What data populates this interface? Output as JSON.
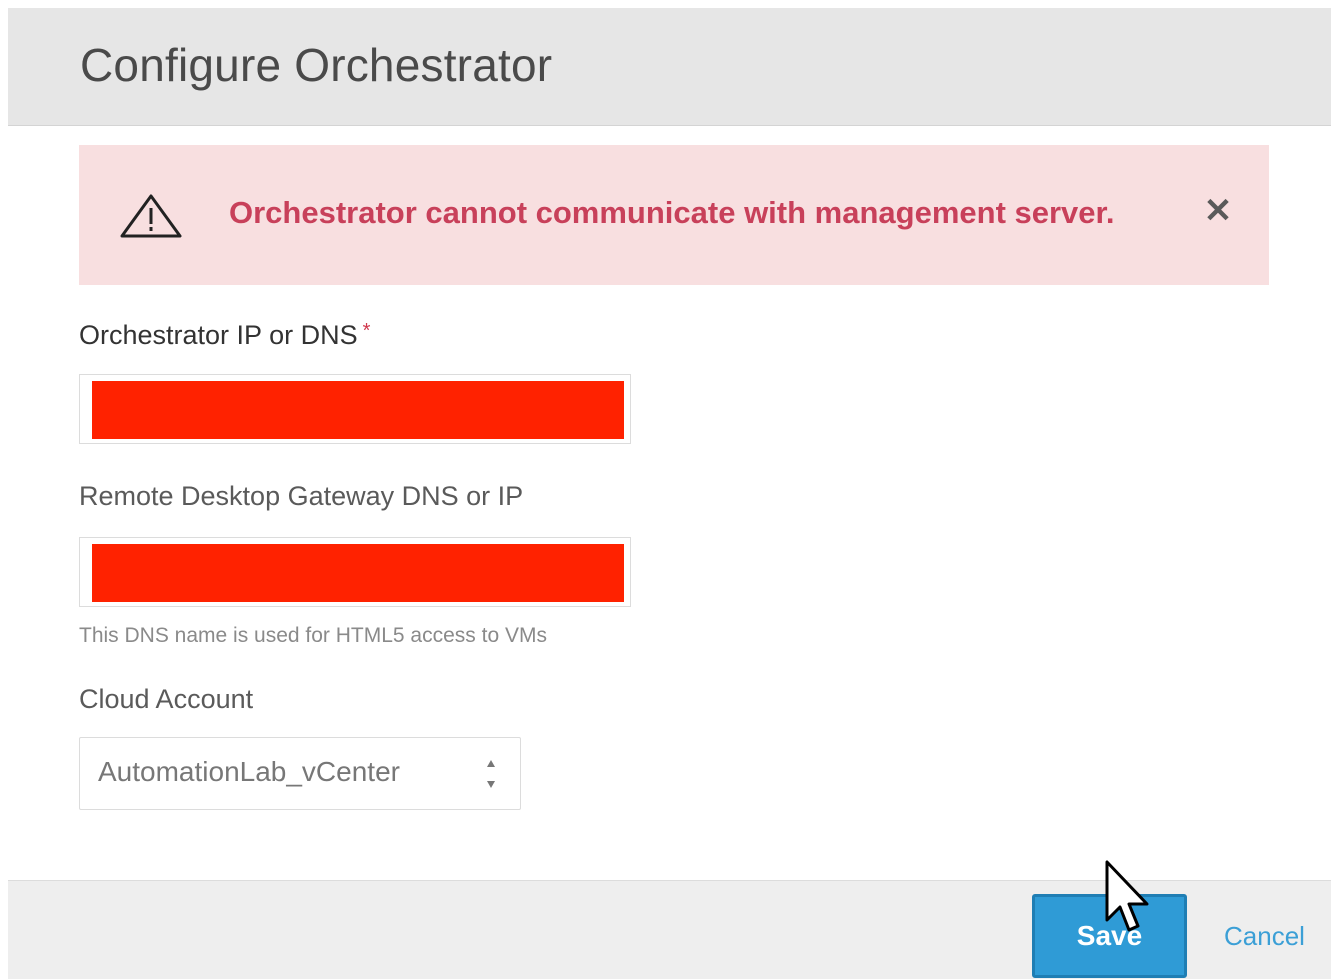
{
  "dialog": {
    "title": "Configure Orchestrator"
  },
  "alert": {
    "icon": "warning-triangle-icon",
    "message": "Orchestrator cannot communicate with management server.",
    "close_glyph": "✕",
    "background_color": "#f8dfe0",
    "text_color": "#c8405a"
  },
  "form": {
    "orchestrator_ip": {
      "label": "Orchestrator IP or DNS",
      "required_mark": "*",
      "value_redacted": true
    },
    "gateway": {
      "label": "Remote Desktop Gateway DNS or IP",
      "value_redacted": true,
      "helper": "This DNS name is used for HTML5 access to VMs"
    },
    "cloud_account": {
      "label": "Cloud Account",
      "selected": "AutomationLab_vCenter"
    }
  },
  "footer": {
    "save_label": "Save",
    "cancel_label": "Cancel",
    "save_color": "#2f9bd6"
  }
}
